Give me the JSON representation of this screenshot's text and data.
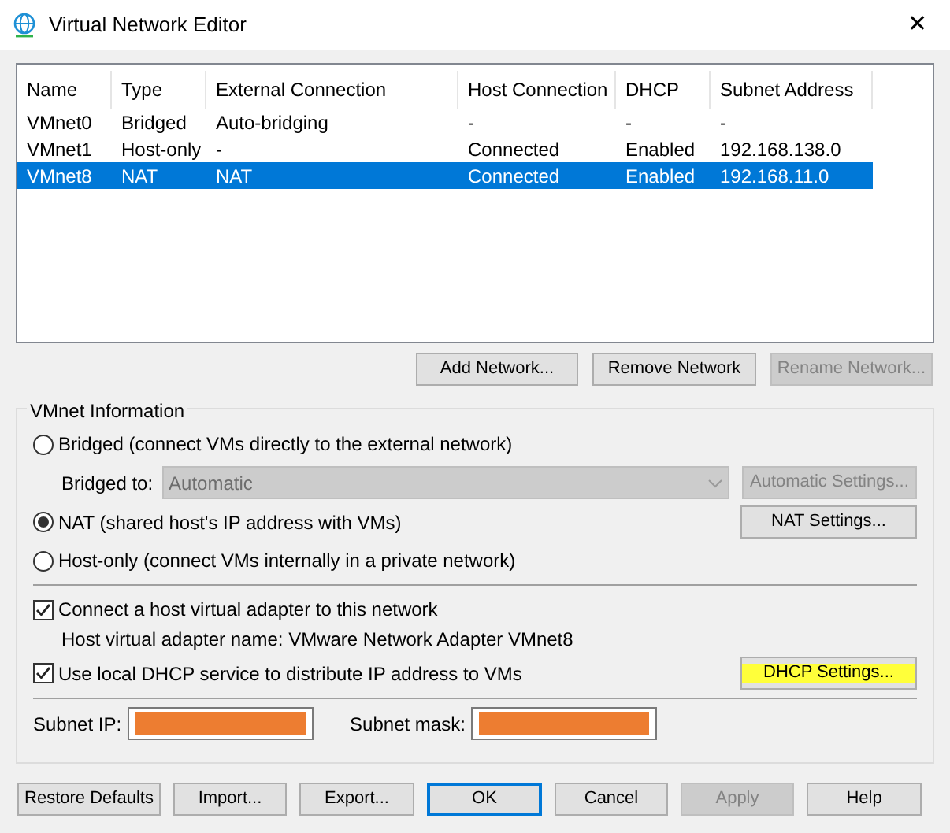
{
  "window": {
    "title": "Virtual Network Editor",
    "close": "✕"
  },
  "table": {
    "columns": [
      "Name",
      "Type",
      "External Connection",
      "Host Connection",
      "DHCP",
      "Subnet Address"
    ],
    "rows": [
      {
        "cells": [
          "VMnet0",
          "Bridged",
          "Auto-bridging",
          "-",
          "-",
          "-"
        ],
        "selected": false
      },
      {
        "cells": [
          "VMnet1",
          "Host-only",
          "-",
          "Connected",
          "Enabled",
          "192.168.138.0"
        ],
        "selected": false
      },
      {
        "cells": [
          "VMnet8",
          "NAT",
          "NAT",
          "Connected",
          "Enabled",
          "192.168.11.0"
        ],
        "selected": true
      }
    ]
  },
  "network_buttons": [
    {
      "label": "Add Network...",
      "disabled": false
    },
    {
      "label": "Remove Network",
      "disabled": false
    },
    {
      "label": "Rename Network...",
      "disabled": true
    }
  ],
  "vmnet_info": {
    "legend": "VMnet Information",
    "bridged": {
      "label": "Bridged (connect VMs directly to the external network)",
      "selected": false
    },
    "bridged_to": {
      "label": "Bridged to:",
      "value": "Automatic",
      "disabled": true,
      "button": {
        "label": "Automatic Settings...",
        "disabled": true
      }
    },
    "nat": {
      "label": "NAT (shared host's IP address with VMs)",
      "selected": true,
      "button": {
        "label": "NAT Settings...",
        "disabled": false
      }
    },
    "host_only": {
      "label": "Host-only (connect VMs internally in a private network)",
      "selected": false
    },
    "connect_adapter": {
      "label": "Connect a host virtual adapter to this network",
      "checked": true
    },
    "adapter_name": "Host virtual adapter name: VMware Network Adapter VMnet8",
    "use_dhcp": {
      "label": "Use local DHCP service to distribute IP address to VMs",
      "checked": true
    },
    "dhcp_button": {
      "label": "DHCP Settings...",
      "highlighted": true,
      "disabled": false
    },
    "subnet_ip": {
      "label": "Subnet IP:",
      "redacted": true
    },
    "subnet_mask": {
      "label": "Subnet mask:",
      "redacted": true
    }
  },
  "footer_buttons": [
    {
      "label": "Restore Defaults",
      "disabled": false,
      "default": false
    },
    {
      "label": "Import...",
      "disabled": false,
      "default": false
    },
    {
      "label": "Export...",
      "disabled": false,
      "default": false
    },
    {
      "label": "OK",
      "disabled": false,
      "default": true
    },
    {
      "label": "Cancel",
      "disabled": false,
      "default": false
    },
    {
      "label": "Apply",
      "disabled": true,
      "default": false
    },
    {
      "label": "Help",
      "disabled": false,
      "default": false
    }
  ]
}
